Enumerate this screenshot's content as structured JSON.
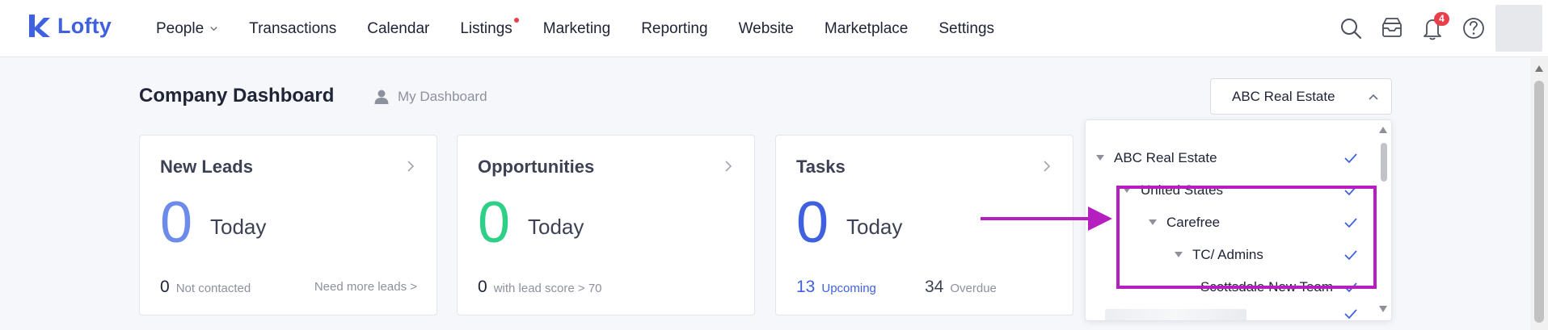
{
  "app": {
    "logo_text": "Lofty",
    "brand_color": "#3f61e0"
  },
  "nav": {
    "items": [
      {
        "label": "People",
        "has_dropdown": true
      },
      {
        "label": "Transactions"
      },
      {
        "label": "Calendar"
      },
      {
        "label": "Listings",
        "has_dot": true
      },
      {
        "label": "Marketing"
      },
      {
        "label": "Reporting"
      },
      {
        "label": "Website"
      },
      {
        "label": "Marketplace"
      },
      {
        "label": "Settings"
      }
    ],
    "icons": [
      "search-icon",
      "inbox-icon",
      "bell-icon",
      "help-icon"
    ],
    "notification_count": "4"
  },
  "header": {
    "title": "Company Dashboard",
    "my_dashboard": "My Dashboard",
    "org_select_value": "ABC Real Estate"
  },
  "cards": {
    "leads": {
      "title": "New Leads",
      "value": "0",
      "value_color": "#6c8bea",
      "period": "Today",
      "foot_num": "0",
      "foot_text": "Not contacted",
      "foot_link": "Need more leads >"
    },
    "opportunities": {
      "title": "Opportunities",
      "value": "0",
      "value_color": "#2ecf87",
      "period": "Today",
      "foot_num": "0",
      "foot_text": "with lead score > 70"
    },
    "tasks": {
      "title": "Tasks",
      "value": "0",
      "value_color": "#3f61e0",
      "period": "Today",
      "upcoming_num": "13",
      "upcoming_label": "Upcoming",
      "overdue_num": "34",
      "overdue_label": "Overdue"
    }
  },
  "tree": {
    "items": [
      {
        "label": "ABC Real Estate",
        "checked": true,
        "expanded": true
      },
      {
        "label": "United States",
        "checked": true,
        "expanded": true
      },
      {
        "label": "Carefree",
        "checked": true,
        "expanded": true
      },
      {
        "label": "TC/ Admins",
        "checked": true,
        "expanded": true
      },
      {
        "label": "Scottsdale New Team",
        "checked": true
      },
      {
        "label": "",
        "checked": true,
        "redacted": true
      }
    ],
    "check_color": "#3f61e0"
  },
  "annotation": {
    "color": "#b61fbf"
  }
}
